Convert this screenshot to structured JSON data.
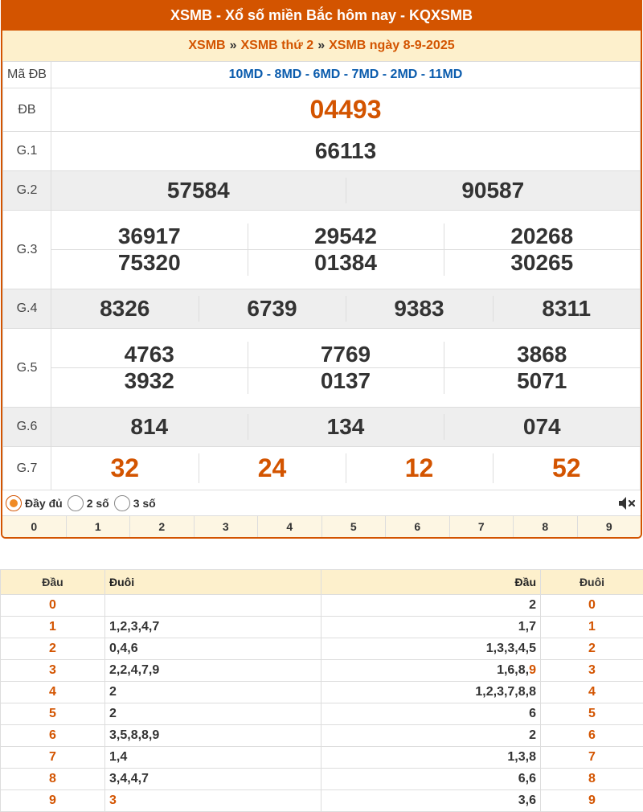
{
  "header": {
    "title": "XSMB - Xổ số miền Bắc hôm nay - KQXSMB"
  },
  "breadcrumb": [
    "XSMB",
    "XSMB thứ 2",
    "XSMB ngày 8-9-2025"
  ],
  "breadcrumb_sep": "»",
  "results": {
    "madb_label": "Mã ĐB",
    "madb": "10MD - 8MD - 6MD - 7MD - 2MD - 11MD",
    "db_label": "ĐB",
    "db": "04493",
    "g1_label": "G.1",
    "g1": [
      "66113"
    ],
    "g2_label": "G.2",
    "g2": [
      "57584",
      "90587"
    ],
    "g3_label": "G.3",
    "g3": [
      "36917",
      "29542",
      "20268",
      "75320",
      "01384",
      "30265"
    ],
    "g4_label": "G.4",
    "g4": [
      "8326",
      "6739",
      "9383",
      "8311"
    ],
    "g5_label": "G.5",
    "g5": [
      "4763",
      "7769",
      "3868",
      "3932",
      "0137",
      "5071"
    ],
    "g6_label": "G.6",
    "g6": [
      "814",
      "134",
      "074"
    ],
    "g7_label": "G.7",
    "g7": [
      "32",
      "24",
      "12",
      "52"
    ]
  },
  "display_options": {
    "full": "Đầy đủ",
    "two": "2 số",
    "three": "3 số",
    "selected": "full"
  },
  "digits": [
    "0",
    "1",
    "2",
    "3",
    "4",
    "5",
    "6",
    "7",
    "8",
    "9"
  ],
  "loto": {
    "headers": [
      "Đầu",
      "Đuôi",
      "Đầu",
      "Đuôi"
    ],
    "rows": [
      {
        "dau": "0",
        "duoi": "",
        "dau2": "2",
        "duoi2": "0"
      },
      {
        "dau": "1",
        "duoi": "1,2,3,4,7",
        "dau2": "1,7",
        "duoi2": "1"
      },
      {
        "dau": "2",
        "duoi": "0,4,6",
        "dau2": "1,3,3,4,5",
        "duoi2": "2"
      },
      {
        "dau": "3",
        "duoi": "2,2,4,7,9",
        "dau2": "1,6,8,",
        "dau2_hl": "9",
        "duoi2": "3"
      },
      {
        "dau": "4",
        "duoi": "2",
        "dau2": "1,2,3,7,8,8",
        "duoi2": "4"
      },
      {
        "dau": "5",
        "duoi": "2",
        "dau2": "6",
        "duoi2": "5"
      },
      {
        "dau": "6",
        "duoi": "3,5,8,8,9",
        "dau2": "2",
        "duoi2": "6"
      },
      {
        "dau": "7",
        "duoi": "1,4",
        "dau2": "1,3,8",
        "duoi2": "7"
      },
      {
        "dau": "8",
        "duoi": "3,4,4,7",
        "dau2": "6,6",
        "duoi2": "8"
      },
      {
        "dau": "9",
        "duoi": "",
        "duoi_hl": "3",
        "dau2": "3,6",
        "duoi2": "9"
      }
    ]
  },
  "colors": {
    "accent": "#d35400",
    "crumb_bg": "#fdf0cc",
    "madb": "#0b5cad",
    "alt_row": "#eeeeee"
  }
}
